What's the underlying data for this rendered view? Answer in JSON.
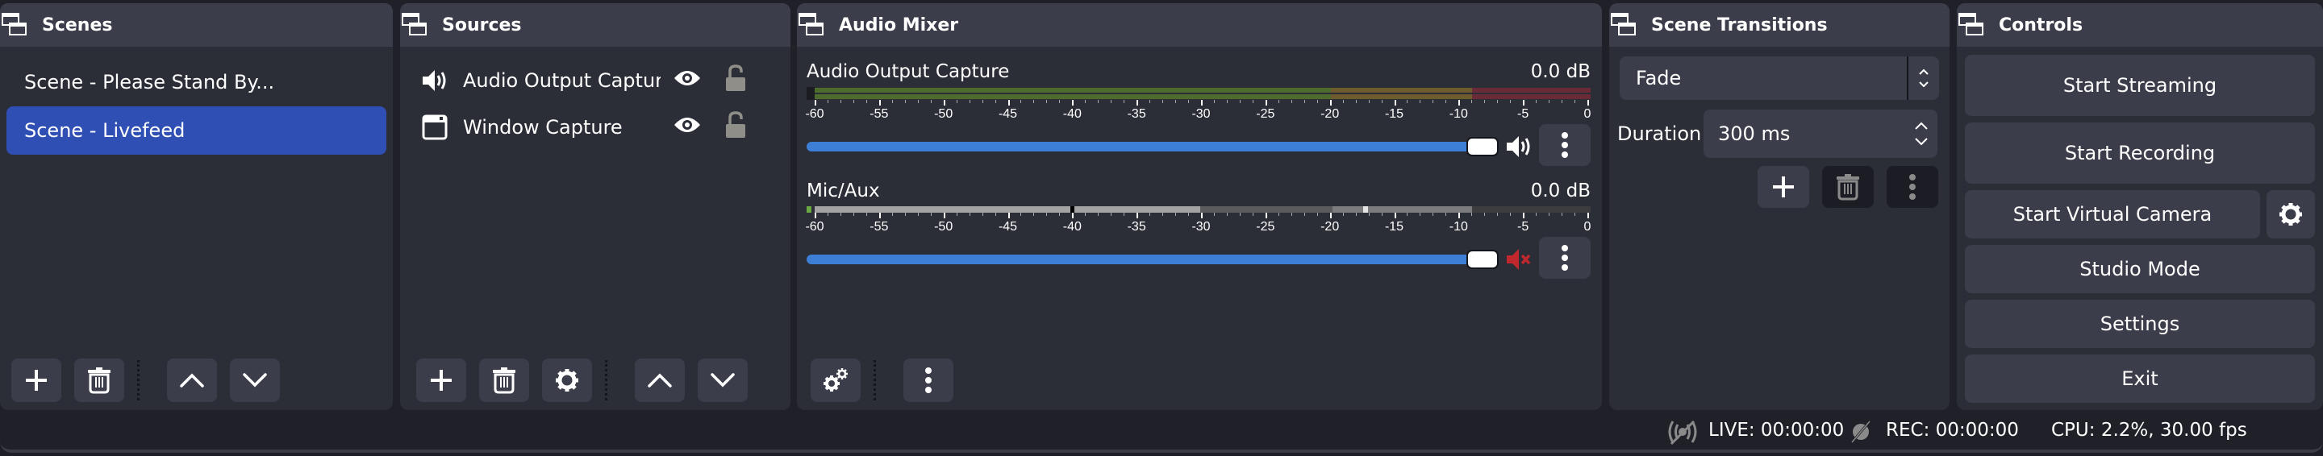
{
  "scenes": {
    "title": "Scenes",
    "items": [
      {
        "label": "Scene - Please Stand By...",
        "selected": false
      },
      {
        "label": "Scene - Livefeed",
        "selected": true
      }
    ]
  },
  "sources": {
    "title": "Sources",
    "items": [
      {
        "label": "Audio Output Capture",
        "type_icon": "speaker-icon",
        "visible": true,
        "locked": false
      },
      {
        "label": "Window Capture",
        "type_icon": "window-icon",
        "visible": true,
        "locked": false
      }
    ]
  },
  "mixer": {
    "title": "Audio Mixer",
    "scale_labels": [
      "-60",
      "-55",
      "-50",
      "-45",
      "-40",
      "-35",
      "-30",
      "-25",
      "-20",
      "-15",
      "-10",
      "-5",
      "0"
    ],
    "channels": [
      {
        "name": "Audio Output Capture",
        "level": "0.0 dB",
        "volume_fraction": 1.0,
        "muted": false
      },
      {
        "name": "Mic/Aux",
        "level": "0.0 dB",
        "volume_fraction": 1.0,
        "muted": true
      }
    ]
  },
  "transitions": {
    "title": "Scene Transitions",
    "selected": "Fade",
    "duration_label": "Duration",
    "duration_value": "300 ms"
  },
  "controls": {
    "title": "Controls",
    "start_streaming": "Start Streaming",
    "start_recording": "Start Recording",
    "start_virtual_camera": "Start Virtual Camera",
    "studio_mode": "Studio Mode",
    "settings": "Settings",
    "exit": "Exit"
  },
  "status": {
    "live": "LIVE: 00:00:00",
    "rec": "REC: 00:00:00",
    "cpu": "CPU: 2.2%, 30.00 fps"
  },
  "colors": {
    "accent_selected": "#2f4fb4",
    "slider": "#3d7fd6",
    "meter_green": "#4c6b2c",
    "meter_yellow": "#6e5c2f",
    "meter_red": "#6b2a37",
    "muted_red": "#c0282e"
  }
}
